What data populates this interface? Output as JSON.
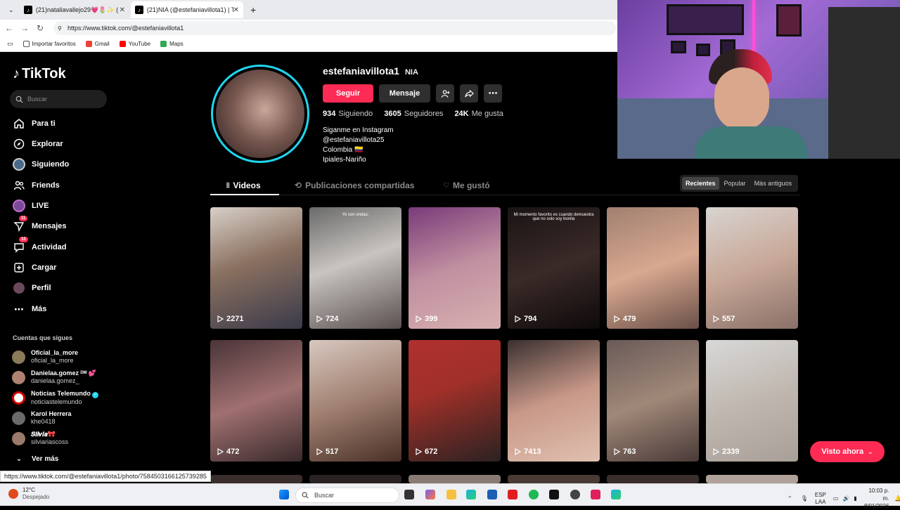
{
  "browser": {
    "tabs": [
      {
        "title": "(21)nataliavallejo29💗🌷✨ (@na"
      },
      {
        "title": "(21)NIA (@estefaniavillota1) | TikT"
      }
    ],
    "new_tab": "+",
    "url": "https://www.tiktok.com/@estefaniavillota1",
    "bookmarks": [
      "Importar favoritos",
      "Gmail",
      "YouTube",
      "Maps"
    ]
  },
  "sidebar": {
    "logo": "TikTok",
    "search_placeholder": "Buscar",
    "nav": [
      {
        "label": "Para ti",
        "icon": "home-icon"
      },
      {
        "label": "Explorar",
        "icon": "compass-icon"
      },
      {
        "label": "Siguiendo",
        "icon": "following-avatar-icon"
      },
      {
        "label": "Friends",
        "icon": "friends-icon"
      },
      {
        "label": "LIVE",
        "icon": "live-icon"
      },
      {
        "label": "Mensajes",
        "icon": "messages-icon",
        "badge": "11"
      },
      {
        "label": "Actividad",
        "icon": "activity-icon",
        "badge": "10"
      },
      {
        "label": "Cargar",
        "icon": "upload-icon"
      },
      {
        "label": "Perfil",
        "icon": "profile-icon"
      },
      {
        "label": "Más",
        "icon": "more-icon"
      }
    ],
    "following_title": "Cuentas que sigues",
    "accounts": [
      {
        "name": "Oficial_la_more",
        "user": "oficial_la_more"
      },
      {
        "name": "Danielaa.gomez ᴰᴹ 💕",
        "user": "danielaa.gomez_"
      },
      {
        "name": "Noticias Telemundo",
        "user": "noticiastelemundo"
      },
      {
        "name": "Karol Herrera",
        "user": "khe0418"
      },
      {
        "name": "𝑺𝒊𝒍𝒗𝒊𝒂🎀",
        "user": "silviariascoss"
      }
    ],
    "see_more": "Ver más"
  },
  "profile": {
    "username": "estefaniavillota1",
    "nickname": "NIA",
    "follow": "Seguir",
    "message": "Mensaje",
    "stats": [
      {
        "value": "934",
        "label": "Siguiendo"
      },
      {
        "value": "3605",
        "label": "Seguidores"
      },
      {
        "value": "24K",
        "label": "Me gusta"
      }
    ],
    "bio": [
      "Siganme en Instagram",
      "@estefaniavillota25",
      "Colombia 🇨🇴",
      "Ipiales-Nariño"
    ]
  },
  "tabs": [
    "Videos",
    "Publicaciones compartidas",
    "Me gustó"
  ],
  "sort": [
    "Recientes",
    "Popular",
    "Más antiguos"
  ],
  "videos": [
    {
      "views": "2271",
      "caption": ""
    },
    {
      "views": "724",
      "caption": "Yo con ondas:"
    },
    {
      "views": "399",
      "caption": ""
    },
    {
      "views": "794",
      "caption": "Mi momento favorito es cuando demuestra que no solo soy bonita"
    },
    {
      "views": "479",
      "caption": ""
    },
    {
      "views": "557",
      "caption": ""
    },
    {
      "views": "472",
      "caption": ""
    },
    {
      "views": "517",
      "caption": ""
    },
    {
      "views": "672",
      "caption": ""
    },
    {
      "views": "7413",
      "caption": ""
    },
    {
      "views": "763",
      "caption": ""
    },
    {
      "views": "2339",
      "caption": ""
    }
  ],
  "visto_ahora": "Visto ahora",
  "status_url": "https://www.tiktok.com/@estefaniavillota1/photo/7584503166125739285",
  "taskbar": {
    "temp": "12°C",
    "weather": "Despejado",
    "search": "Buscar",
    "lang1": "ESP",
    "lang2": "LAA",
    "time": "10:03 p. m.",
    "date": "8/01/2026"
  },
  "colors": {
    "accent": "#fe2c55",
    "ring": "#20d5ec",
    "bg": "#000000"
  }
}
